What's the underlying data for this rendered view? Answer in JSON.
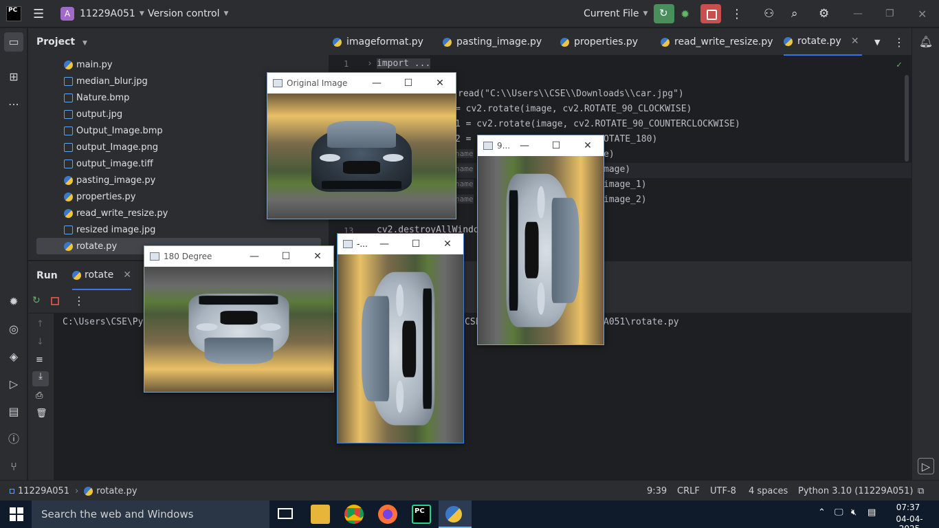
{
  "titlebar": {
    "logo": "PC",
    "project_badge": "A",
    "project_name": "11229A051",
    "vcs": "Version control",
    "run_config": "Current File"
  },
  "project_panel": {
    "title": "Project",
    "files": [
      {
        "name": "main.py",
        "type": "py"
      },
      {
        "name": "median_blur.jpg",
        "type": "img"
      },
      {
        "name": "Nature.bmp",
        "type": "img"
      },
      {
        "name": "output.jpg",
        "type": "img"
      },
      {
        "name": "Output_Image.bmp",
        "type": "img"
      },
      {
        "name": "output_Image.png",
        "type": "img"
      },
      {
        "name": "output_image.tiff",
        "type": "img"
      },
      {
        "name": "pasting_image.py",
        "type": "py"
      },
      {
        "name": "properties.py",
        "type": "py"
      },
      {
        "name": "read_write_resize.py",
        "type": "py"
      },
      {
        "name": "resized image.jpg",
        "type": "img"
      },
      {
        "name": "rotate.py",
        "type": "py",
        "selected": true
      }
    ]
  },
  "tabs": [
    {
      "label": "imageformat.py"
    },
    {
      "label": "pasting_image.py"
    },
    {
      "label": "properties.py"
    },
    {
      "label": "read_write_resize.py"
    },
    {
      "label": "rotate.py",
      "active": true
    }
  ],
  "editor": {
    "line1_num": "1",
    "line1": "import ...",
    "line2": "read(\"C:\\\\Users\\\\CSE\\\\Downloads\\\\car.jpg\")",
    "line3": "= cv2.rotate(image, cv2.ROTATE_90_CLOCKWISE)",
    "line4": "1 = cv2.rotate(image, cv2.ROTATE_90_COUNTERCLOCKWISE)",
    "line5": "2 = c",
    "line5b": "OTATE_180)",
    "line6": "name",
    "line6b": "e)",
    "line7": "name",
    "line7b": "mage)",
    "line8": "name",
    "line8b": "image_1)",
    "line9": "name",
    "line9b": "image_2)",
    "line13_num": "13",
    "line13": "cv2.destroyAllWindo"
  },
  "run_panel": {
    "run_label": "Run",
    "tab_label": "rotate",
    "console_left": "C:\\Users\\CSE\\Py",
    "console_mid": "CSE",
    "console_right": "A051\\rotate.py"
  },
  "cv_windows": {
    "original": "Original Image",
    "deg180": "180 Degree",
    "clockwise": "-...",
    "ccw": "9..."
  },
  "statusbar": {
    "project": "11229A051",
    "file": "rotate.py",
    "position": "9:39",
    "line_sep": "CRLF",
    "encoding": "UTF-8",
    "indent": "4 spaces",
    "interpreter": "Python 3.10 (11229A051)"
  },
  "taskbar": {
    "search_placeholder": "Search the web and Windows",
    "time": "07:37",
    "date": "04-04-2025"
  }
}
